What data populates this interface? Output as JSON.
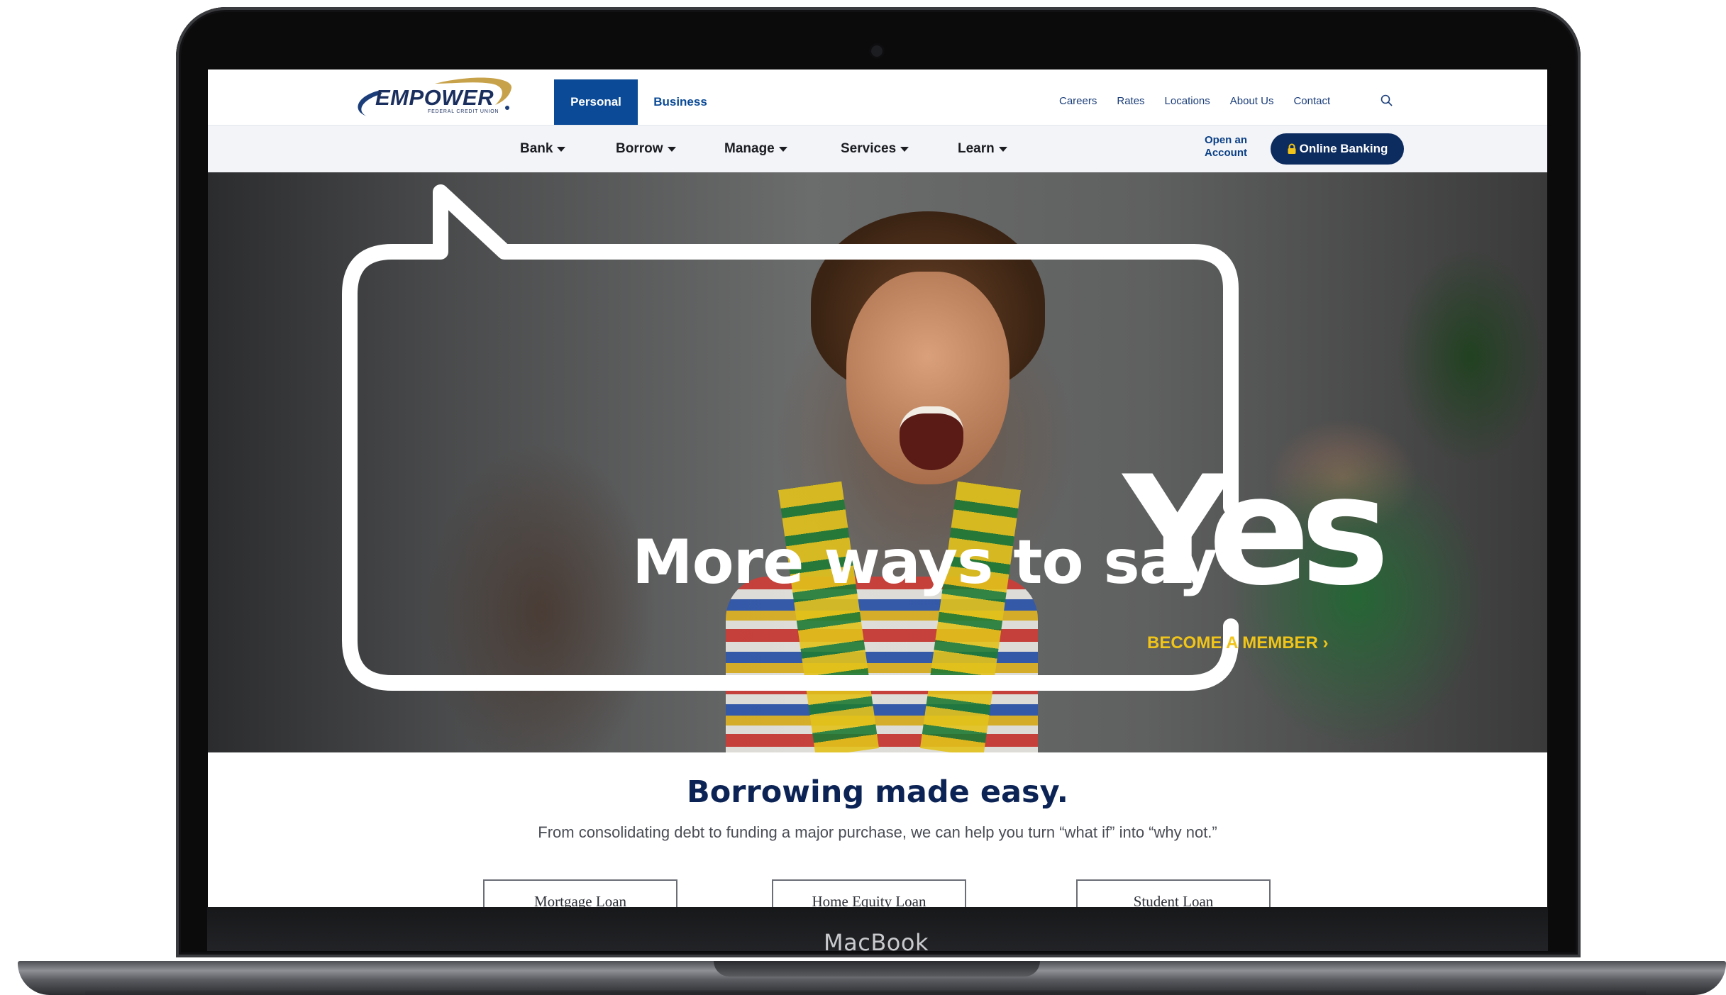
{
  "device": {
    "brand_label": "MacBook"
  },
  "site": {
    "logo": {
      "name": "EMPOWER",
      "subtitle": "FEDERAL CREDIT UNION"
    },
    "audience_tabs": [
      {
        "label": "Personal",
        "active": true
      },
      {
        "label": "Business",
        "active": false
      }
    ],
    "utility_links": [
      "Careers",
      "Rates",
      "Locations",
      "About Us",
      "Contact"
    ],
    "main_nav": [
      "Bank",
      "Borrow",
      "Manage",
      "Services",
      "Learn"
    ],
    "open_account_line1": "Open an",
    "open_account_line2": "Account",
    "online_banking_label": "Online Banking",
    "colors": {
      "primary": "#0a4a96",
      "dark_navy": "#0c2b5f",
      "accent_yellow": "#f0c419"
    }
  },
  "hero": {
    "headline": "More ways to say",
    "headline_emphasis": "Yes",
    "cta": "BECOME A MEMBER ›"
  },
  "section": {
    "title": "Borrowing made easy.",
    "subtitle": "From consolidating debt to funding a major purchase, we can help you turn “what if” into “why not.”",
    "loan_buttons": [
      "Mortgage Loan",
      "Home Equity Loan",
      "Student Loan"
    ]
  }
}
